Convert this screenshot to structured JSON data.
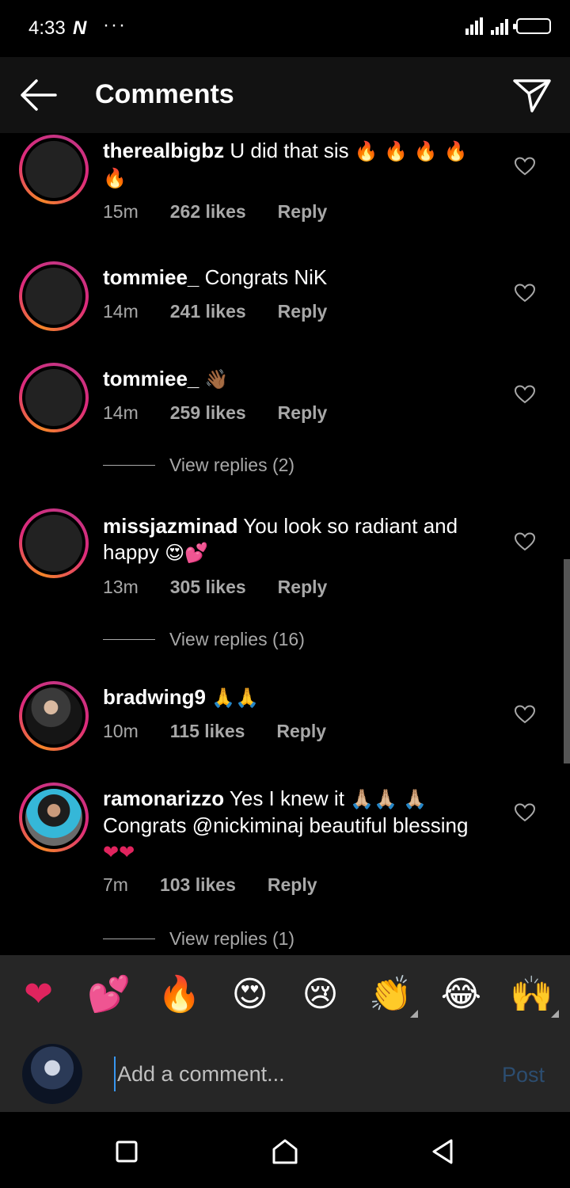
{
  "status_bar": {
    "time": "4:33",
    "notification_icon": "N",
    "more": "···"
  },
  "header": {
    "title": "Comments",
    "back_icon": "arrow-left-icon",
    "share_icon": "send-icon"
  },
  "comments": [
    {
      "username": "therealbigbz",
      "text": "U did that sis",
      "emojis": "🔥 🔥 🔥 🔥 🔥",
      "time": "15m",
      "likes": "262 likes",
      "reply": "Reply"
    },
    {
      "username": "tommiee_",
      "text": "Congrats NiK",
      "emojis": "",
      "time": "14m",
      "likes": "241 likes",
      "reply": "Reply"
    },
    {
      "username": "tommiee_",
      "text": "",
      "emojis": "👋🏾",
      "time": "14m",
      "likes": "259 likes",
      "reply": "Reply",
      "view_replies": "View replies (2)"
    },
    {
      "username": "missjazminad",
      "text": "You look so radiant and happy",
      "emojis": "😍💕",
      "time": "13m",
      "likes": "305 likes",
      "reply": "Reply",
      "view_replies": "View replies (16)"
    },
    {
      "username": "bradwing9",
      "text": "",
      "emojis": "🙏🙏",
      "time": "10m",
      "likes": "115 likes",
      "reply": "Reply"
    },
    {
      "username": "ramonarizzo",
      "text_a": "Yes I knew it",
      "emojis_a": "🙏🏼🙏🏼",
      "emojis_b": "🙏🏼",
      "text_b": "Congrats @nickiminaj beautiful blessing",
      "emojis_c": "❤❤",
      "time": "7m",
      "likes": "103 likes",
      "reply": "Reply",
      "view_replies": "View replies (1)"
    }
  ],
  "reactions": [
    "❤",
    "💕",
    "🔥",
    "😍",
    "😢",
    "👏",
    "😂",
    "🙌"
  ],
  "composer": {
    "placeholder": "Add a comment...",
    "post": "Post"
  },
  "colors": {
    "background": "#000000",
    "header": "#121212",
    "bar": "#262626",
    "secondary_text": "#a8a8a8",
    "post_disabled": "#2c4d70"
  }
}
